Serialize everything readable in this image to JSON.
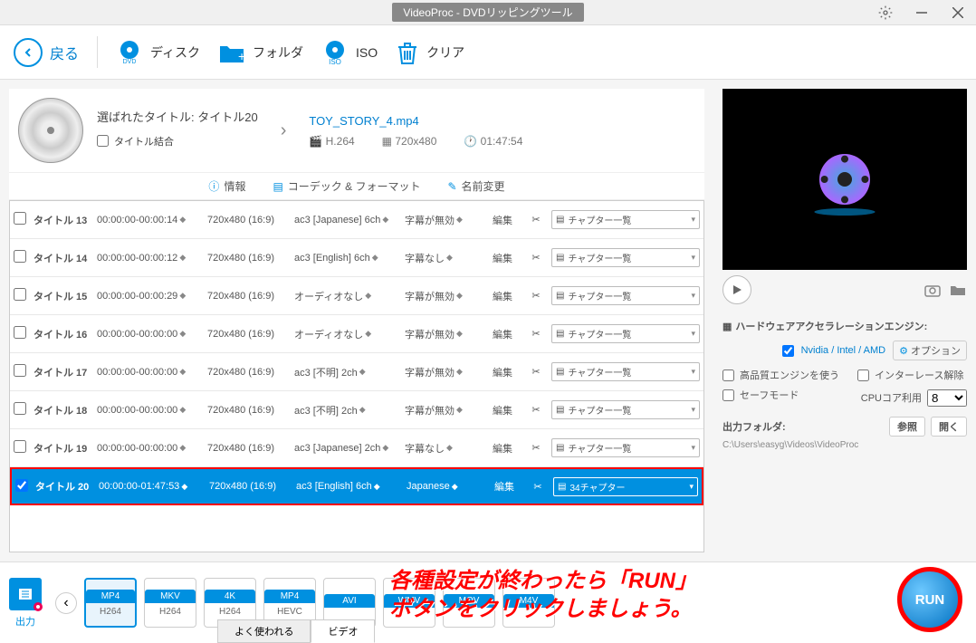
{
  "window": {
    "title": "VideoProc - DVDリッピングツール"
  },
  "toolbar": {
    "back": "戻る",
    "disc": "ディスク",
    "folder": "フォルダ",
    "iso": "ISO",
    "clear": "クリア"
  },
  "selected": {
    "label": "選ばれたタイトル: タイトル20",
    "merge": "タイトル結合"
  },
  "output": {
    "filename": "TOY_STORY_4.mp4",
    "codec": "H.264",
    "resolution": "720x480",
    "duration": "01:47:54"
  },
  "subbar": {
    "info": "情報",
    "codec": "コーデック & フォーマット",
    "rename": "名前変更"
  },
  "titles": [
    {
      "name": "タイトル 13",
      "time": "00:00:00-00:00:14",
      "res": "720x480 (16:9)",
      "audio": "ac3 [Japanese] 6ch",
      "sub": "字幕が無効",
      "chap": "チャプター一覧",
      "checked": false
    },
    {
      "name": "タイトル 14",
      "time": "00:00:00-00:00:12",
      "res": "720x480 (16:9)",
      "audio": "ac3 [English] 6ch",
      "sub": "字幕なし",
      "chap": "チャプター一覧",
      "checked": false
    },
    {
      "name": "タイトル 15",
      "time": "00:00:00-00:00:29",
      "res": "720x480 (16:9)",
      "audio": "オーディオなし",
      "sub": "字幕が無効",
      "chap": "チャプター一覧",
      "checked": false
    },
    {
      "name": "タイトル 16",
      "time": "00:00:00-00:00:00",
      "res": "720x480 (16:9)",
      "audio": "オーディオなし",
      "sub": "字幕が無効",
      "chap": "チャプター一覧",
      "checked": false
    },
    {
      "name": "タイトル 17",
      "time": "00:00:00-00:00:00",
      "res": "720x480 (16:9)",
      "audio": "ac3 [不明] 2ch",
      "sub": "字幕が無効",
      "chap": "チャプター一覧",
      "checked": false
    },
    {
      "name": "タイトル 18",
      "time": "00:00:00-00:00:00",
      "res": "720x480 (16:9)",
      "audio": "ac3 [不明] 2ch",
      "sub": "字幕が無効",
      "chap": "チャプター一覧",
      "checked": false
    },
    {
      "name": "タイトル 19",
      "time": "00:00:00-00:00:00",
      "res": "720x480 (16:9)",
      "audio": "ac3 [Japanese] 2ch",
      "sub": "字幕なし",
      "chap": "チャプター一覧",
      "checked": false
    },
    {
      "name": "タイトル 20",
      "time": "00:00:00-01:47:53",
      "res": "720x480 (16:9)",
      "audio": "ac3 [English] 6ch",
      "sub": "Japanese",
      "chap": "34チャプター",
      "checked": true,
      "selected": true
    }
  ],
  "editLabel": "編集",
  "hw": {
    "title": "ハードウェアアクセラレーションエンジン:",
    "vendors": "Nvidia / Intel / AMD",
    "options": "オプション",
    "hq": "高品質エンジンを使う",
    "deint": "インターレース解除",
    "safe": "セーフモード",
    "cpuLabel": "CPUコア利用",
    "cpuValue": "8"
  },
  "outfolder": {
    "title": "出力フォルダ:",
    "browse": "参照",
    "open": "開く",
    "path": "C:\\Users\\easyg\\Videos\\VideoProc"
  },
  "output_label": "出力",
  "formats": [
    {
      "top": "MP4",
      "bot": "H264",
      "active": true
    },
    {
      "top": "MKV",
      "bot": "H264"
    },
    {
      "top": "4K",
      "bot": "H264"
    },
    {
      "top": "MP4",
      "bot": "HEVC"
    },
    {
      "top": "AVI",
      "bot": ""
    },
    {
      "top": "WMV",
      "bot": ""
    },
    {
      "top": "MOV",
      "bot": ""
    },
    {
      "top": "M4V",
      "bot": ""
    }
  ],
  "bottomTabs": {
    "popular": "よく使われる",
    "video": "ビデオ"
  },
  "run": "RUN",
  "annotation": {
    "line1": "各種設定が終わったら「RUN」",
    "line2": "ボタンをクリックしましょう。"
  }
}
